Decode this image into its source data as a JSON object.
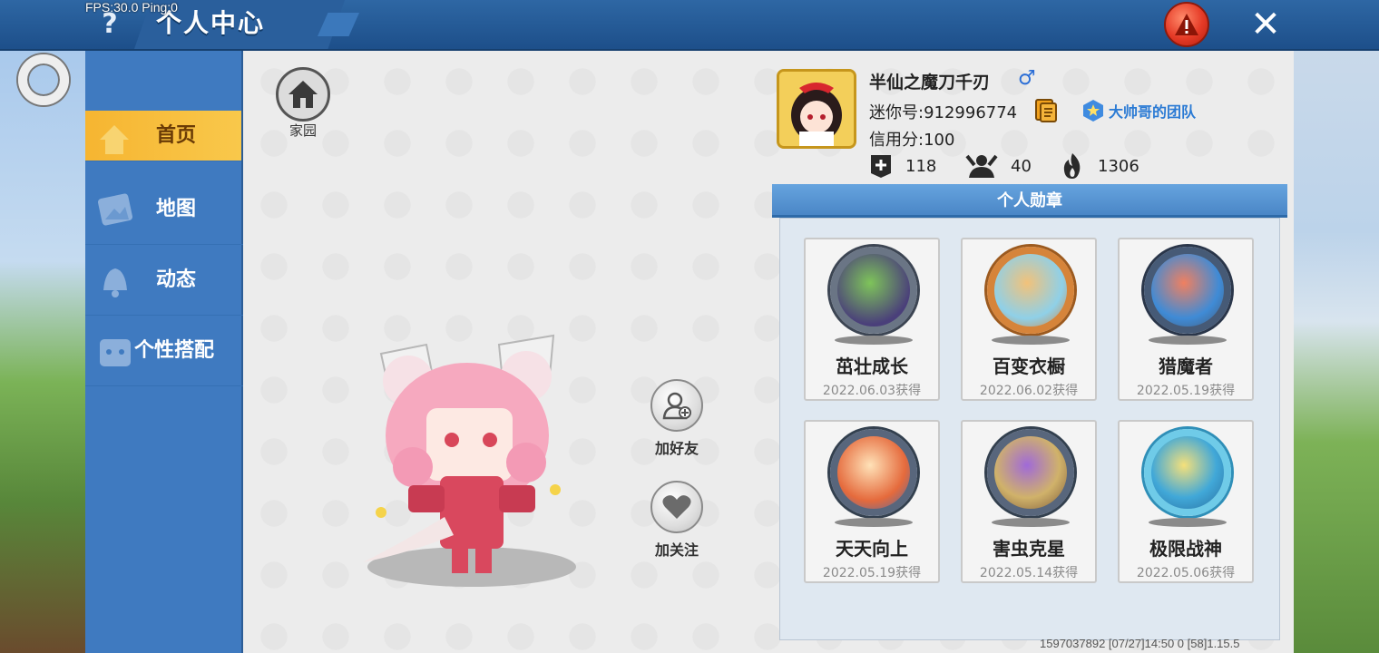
{
  "header": {
    "title": "个人中心",
    "help_icon": "?",
    "fps": "FPS:30.0  Ping:0",
    "close_icon": "✕",
    "colors": {
      "bar": "#1d4f8a",
      "accent": "#f6b531",
      "alert": "#e53a26"
    }
  },
  "sidebar": {
    "items": [
      {
        "label": "首页",
        "icon": "home-icon",
        "active": true
      },
      {
        "label": "地图",
        "icon": "map-icon",
        "active": false
      },
      {
        "label": "动态",
        "icon": "bell-icon",
        "active": false
      },
      {
        "label": "个性搭配",
        "icon": "outfit-icon",
        "active": false
      }
    ]
  },
  "home": {
    "label": "家园",
    "icon": "house-icon"
  },
  "actions": {
    "add_friend": "加好友",
    "follow": "加关注"
  },
  "profile": {
    "name": "半仙之魔刀千刃",
    "gender_icon": "♂",
    "mini_id": "迷你号:912996774",
    "team": "大帅哥的团队",
    "credit": "信用分:100",
    "stats": [
      {
        "icon": "plus-icon",
        "value": "118"
      },
      {
        "icon": "fans-icon",
        "value": "40"
      },
      {
        "icon": "fire-icon",
        "value": "1306"
      }
    ]
  },
  "medals": {
    "title": "个人勋章",
    "items": [
      {
        "name": "茁壮成长",
        "date": "2022.06.03获得",
        "color": "#4a3f7a"
      },
      {
        "name": "百变衣橱",
        "date": "2022.06.02获得",
        "color": "#d6843a"
      },
      {
        "name": "猎魔者",
        "date": "2022.05.19获得",
        "color": "#465a76"
      },
      {
        "name": "天天向上",
        "date": "2022.05.19获得",
        "color": "#e56a3c"
      },
      {
        "name": "害虫克星",
        "date": "2022.05.14获得",
        "color": "#7d5a3a"
      },
      {
        "name": "极限战神",
        "date": "2022.05.06获得",
        "color": "#41a8d8"
      }
    ]
  },
  "footer": "1597037892    [07/27]14:50 0  [58]1.15.5"
}
